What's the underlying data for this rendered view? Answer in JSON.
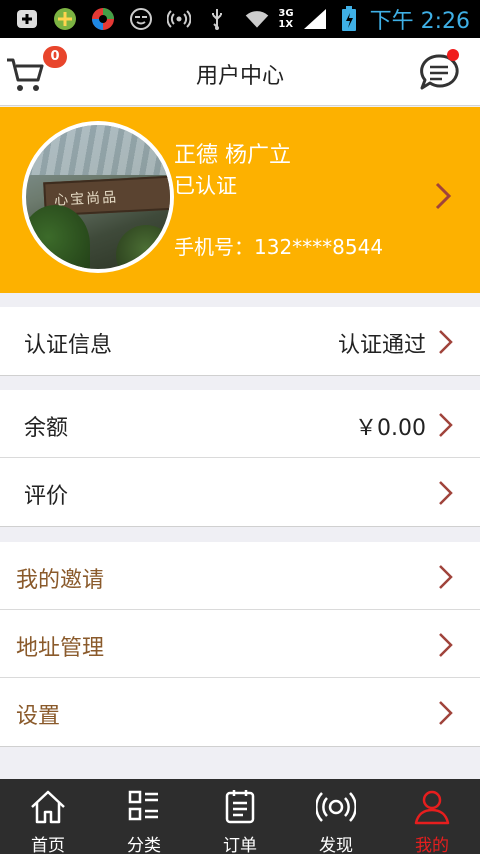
{
  "status_bar": {
    "time": "下午 2:26",
    "network": "3G",
    "network_sub": "1X",
    "icons": [
      "plus-box-icon",
      "gem-icon",
      "ball-icon",
      "smile-icon",
      "wireless-icon",
      "usb-icon",
      "wifi-icon",
      "signal-icon",
      "battery-icon"
    ]
  },
  "header": {
    "title": "用户中心",
    "cart_badge": "0",
    "icons": [
      "cart-icon",
      "message-icon"
    ]
  },
  "profile": {
    "name": "正德 杨广立",
    "status": "已认证",
    "phone": "手机号：132****8544",
    "background": "#fdb100"
  },
  "rows": {
    "verify": {
      "label": "认证信息",
      "value": "认证通过"
    },
    "balance": {
      "label": "余额",
      "value": "￥0.00"
    },
    "review": {
      "label": "评价"
    },
    "invite": {
      "label": "我的邀请"
    },
    "address": {
      "label": "地址管理"
    },
    "settings": {
      "label": "设置"
    }
  },
  "tabs": [
    {
      "label": "首页",
      "icon": "home-icon"
    },
    {
      "label": "分类",
      "icon": "category-icon"
    },
    {
      "label": "订单",
      "icon": "order-icon"
    },
    {
      "label": "发现",
      "icon": "discover-icon"
    },
    {
      "label": "我的",
      "icon": "user-icon",
      "active": true
    }
  ],
  "colors": {
    "accent": "#e61e1e",
    "profile_bg": "#fdb100",
    "chevron": "#a0433b",
    "tabbar_bg": "#2d2d2d"
  }
}
